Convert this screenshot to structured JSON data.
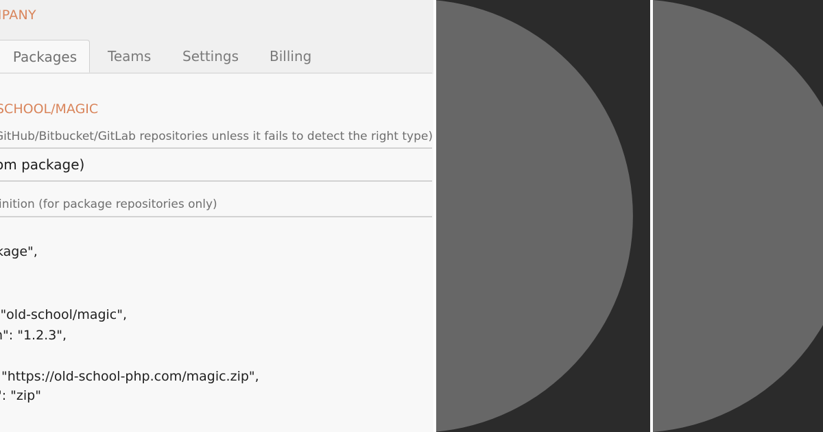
{
  "header": {
    "company_title": "MPANY"
  },
  "tabs": [
    {
      "label": "Packages",
      "active": true
    },
    {
      "label": "Teams",
      "active": false
    },
    {
      "label": "Settings",
      "active": false
    },
    {
      "label": "Billing",
      "active": false
    }
  ],
  "package": {
    "name": "SCHOOL/MAGIC",
    "repository_type_help": "GitHub/Bitbucket/GitLab repositories unless it fails to detect the right type)",
    "repository_type_value": "om package)",
    "definition_help": "finition (for package repositories only)"
  },
  "code": {
    "lines": [
      "kage\",",
      ": \"old-school/magic\",",
      "n\": \"1.2.3\",",
      "\"https://old-school-php.com/magic.zip\",",
      "\": \"zip\""
    ]
  },
  "colors": {
    "accent": "#d9845a",
    "panel_background": "#f8f8f8",
    "dark_background": "#2b2b2b",
    "circle_fill": "#676767"
  }
}
